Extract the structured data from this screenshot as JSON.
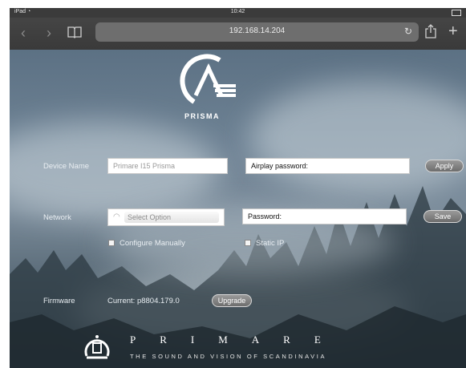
{
  "status_bar": {
    "device": "iPad",
    "time": "10:42"
  },
  "browser": {
    "url": "192.168.14.204",
    "icons": [
      "back-icon",
      "forward-icon",
      "bookmarks-icon",
      "reload-icon",
      "share-icon",
      "new-tab-icon"
    ]
  },
  "logo": {
    "product_text": "PRISMA"
  },
  "device_name": {
    "label": "Device Name",
    "value": "Primare I15 Prisma",
    "airplay_password_label": "Airplay password:",
    "apply_label": "Apply"
  },
  "network": {
    "label": "Network",
    "select_value": "Select Option",
    "password_label": "Password:",
    "save_label": "Save",
    "configure_manually": "Configure Manually",
    "static_ip": "Static IP"
  },
  "firmware": {
    "label": "Firmware",
    "current": "Current: p8804.179.0",
    "upgrade_label": "Upgrade"
  },
  "footer": {
    "brand": "PRIMARE",
    "tagline": "THE SOUND AND VISION OF SCANDINAVIA"
  },
  "colors": {
    "toolbar": "#3a3a3a",
    "urlbar": "#6e6e6e",
    "button": "#7d7d7d",
    "text_light": "#e9eef2"
  }
}
